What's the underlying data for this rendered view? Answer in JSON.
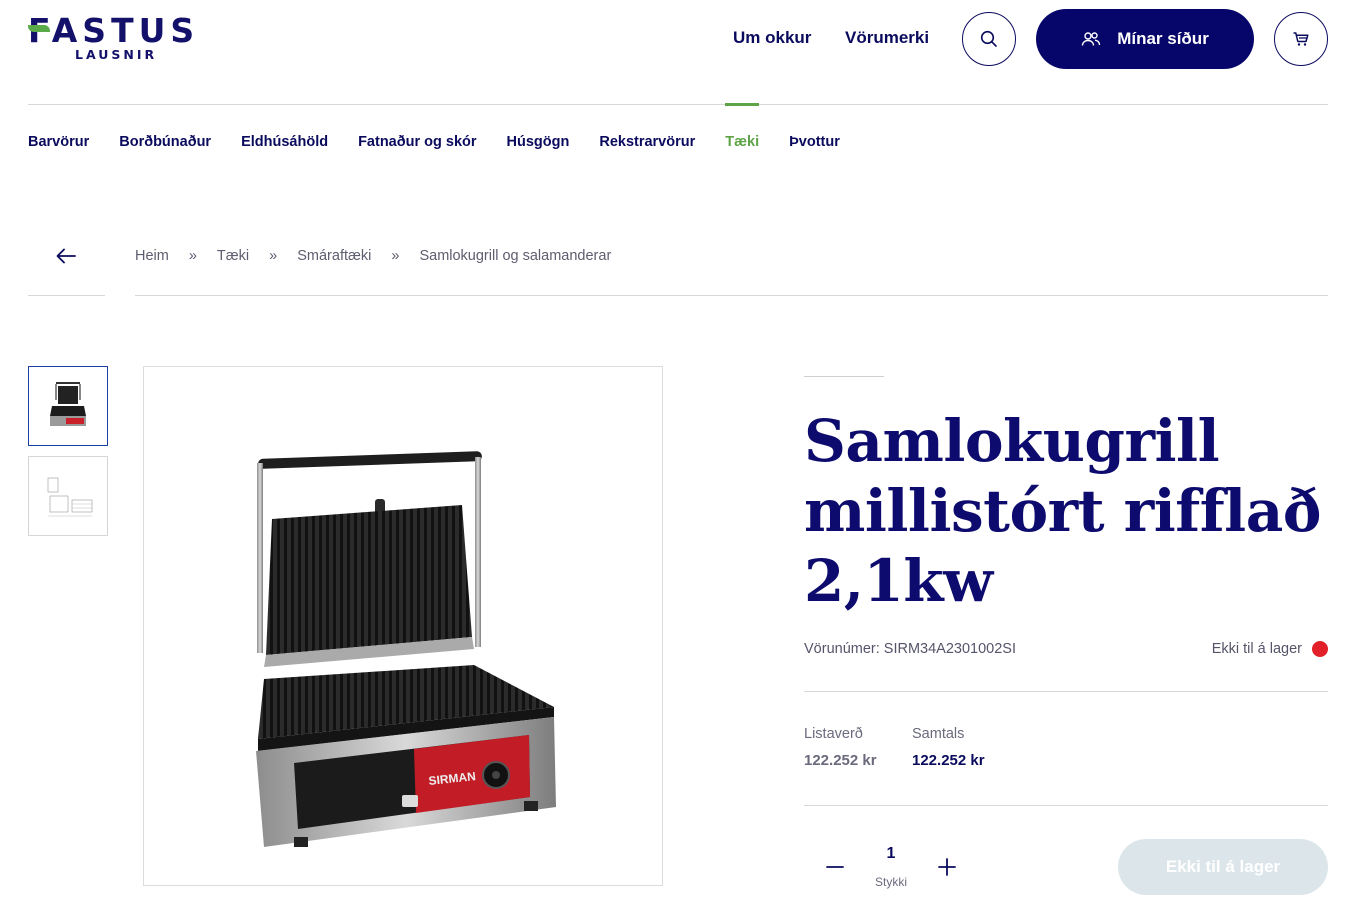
{
  "header": {
    "logo_main": "FASTUS",
    "logo_sub": "LAUSNIR",
    "links": [
      "Um okkur",
      "Vörumerki"
    ],
    "search_icon": "search-icon",
    "account_label": "Mínar síður",
    "account_icon": "users-icon",
    "cart_icon": "cart-icon"
  },
  "categories": {
    "items": [
      "Barvörur",
      "Borðbúnaður",
      "Eldhúsáhöld",
      "Fatnaður og skór",
      "Húsgögn",
      "Rekstrarvörur",
      "Tæki",
      "Þvottur"
    ],
    "active": "Tæki"
  },
  "breadcrumb": {
    "back_icon": "arrow-left-icon",
    "items": [
      "Heim",
      "Tæki",
      "Smáraftæki",
      "Samlokugrill og salamanderar"
    ],
    "separator": "»"
  },
  "product": {
    "title": "Samlokugrill millistórt rifflað 2,1kw",
    "sku": "Vörunúmer: SIRM34A2301002SI",
    "stock_status": "Ekki til á lager",
    "stock_color": "#e1202a",
    "list_price_label": "Listaverð",
    "list_price": "122.252 kr",
    "total_label": "Samtals",
    "total": "122.252 kr",
    "quantity": "1",
    "quantity_unit": "Stykki",
    "cart_button_label": "Ekki til á lager"
  },
  "colors": {
    "brand": "#06066a",
    "accent": "#5ea447",
    "out_of_stock": "#e1202a"
  }
}
